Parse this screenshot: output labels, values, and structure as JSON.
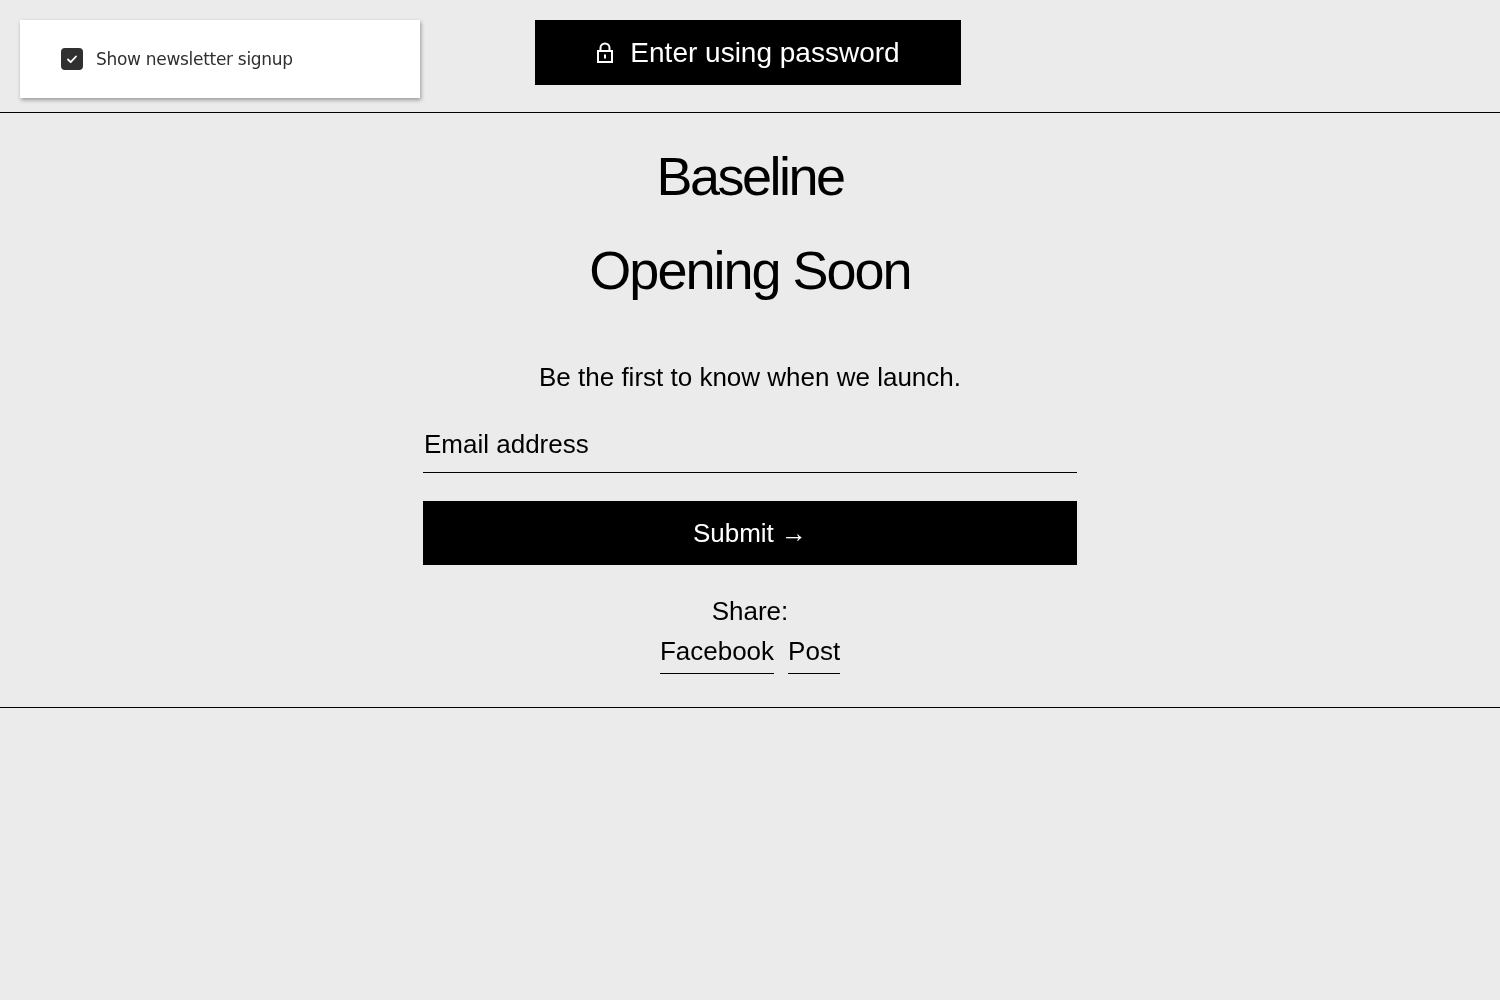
{
  "newsletter_toggle": {
    "label": "Show newsletter signup",
    "checked": true
  },
  "password_button": {
    "label": "Enter using password"
  },
  "store_name": "Baseline",
  "heading": "Opening Soon",
  "tagline": "Be the first to know when we launch.",
  "email_field": {
    "placeholder": "Email address"
  },
  "submit_button": {
    "label": "Submit →"
  },
  "share": {
    "label": "Share:",
    "links": [
      "Facebook",
      "Post"
    ]
  }
}
